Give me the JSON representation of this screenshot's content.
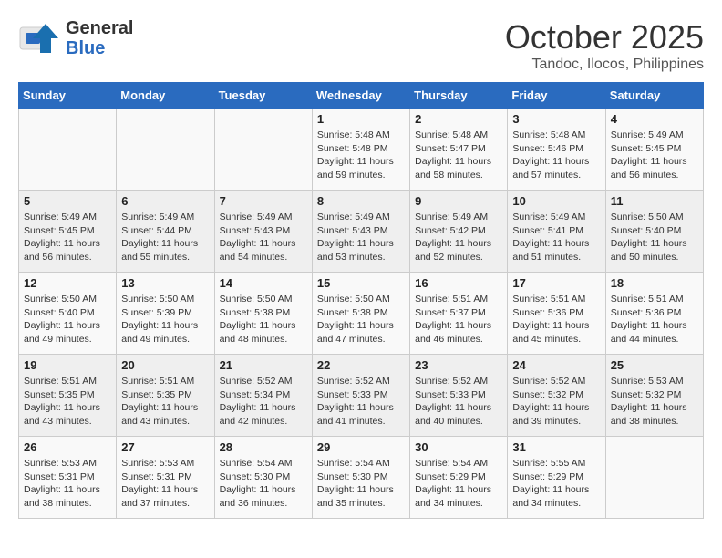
{
  "header": {
    "logo_general": "General",
    "logo_blue": "Blue",
    "month": "October 2025",
    "location": "Tandoc, Ilocos, Philippines"
  },
  "weekdays": [
    "Sunday",
    "Monday",
    "Tuesday",
    "Wednesday",
    "Thursday",
    "Friday",
    "Saturday"
  ],
  "weeks": [
    [
      {
        "day": "",
        "info": ""
      },
      {
        "day": "",
        "info": ""
      },
      {
        "day": "",
        "info": ""
      },
      {
        "day": "1",
        "info": "Sunrise: 5:48 AM\nSunset: 5:48 PM\nDaylight: 11 hours\nand 59 minutes."
      },
      {
        "day": "2",
        "info": "Sunrise: 5:48 AM\nSunset: 5:47 PM\nDaylight: 11 hours\nand 58 minutes."
      },
      {
        "day": "3",
        "info": "Sunrise: 5:48 AM\nSunset: 5:46 PM\nDaylight: 11 hours\nand 57 minutes."
      },
      {
        "day": "4",
        "info": "Sunrise: 5:49 AM\nSunset: 5:45 PM\nDaylight: 11 hours\nand 56 minutes."
      }
    ],
    [
      {
        "day": "5",
        "info": "Sunrise: 5:49 AM\nSunset: 5:45 PM\nDaylight: 11 hours\nand 56 minutes."
      },
      {
        "day": "6",
        "info": "Sunrise: 5:49 AM\nSunset: 5:44 PM\nDaylight: 11 hours\nand 55 minutes."
      },
      {
        "day": "7",
        "info": "Sunrise: 5:49 AM\nSunset: 5:43 PM\nDaylight: 11 hours\nand 54 minutes."
      },
      {
        "day": "8",
        "info": "Sunrise: 5:49 AM\nSunset: 5:43 PM\nDaylight: 11 hours\nand 53 minutes."
      },
      {
        "day": "9",
        "info": "Sunrise: 5:49 AM\nSunset: 5:42 PM\nDaylight: 11 hours\nand 52 minutes."
      },
      {
        "day": "10",
        "info": "Sunrise: 5:49 AM\nSunset: 5:41 PM\nDaylight: 11 hours\nand 51 minutes."
      },
      {
        "day": "11",
        "info": "Sunrise: 5:50 AM\nSunset: 5:40 PM\nDaylight: 11 hours\nand 50 minutes."
      }
    ],
    [
      {
        "day": "12",
        "info": "Sunrise: 5:50 AM\nSunset: 5:40 PM\nDaylight: 11 hours\nand 49 minutes."
      },
      {
        "day": "13",
        "info": "Sunrise: 5:50 AM\nSunset: 5:39 PM\nDaylight: 11 hours\nand 49 minutes."
      },
      {
        "day": "14",
        "info": "Sunrise: 5:50 AM\nSunset: 5:38 PM\nDaylight: 11 hours\nand 48 minutes."
      },
      {
        "day": "15",
        "info": "Sunrise: 5:50 AM\nSunset: 5:38 PM\nDaylight: 11 hours\nand 47 minutes."
      },
      {
        "day": "16",
        "info": "Sunrise: 5:51 AM\nSunset: 5:37 PM\nDaylight: 11 hours\nand 46 minutes."
      },
      {
        "day": "17",
        "info": "Sunrise: 5:51 AM\nSunset: 5:36 PM\nDaylight: 11 hours\nand 45 minutes."
      },
      {
        "day": "18",
        "info": "Sunrise: 5:51 AM\nSunset: 5:36 PM\nDaylight: 11 hours\nand 44 minutes."
      }
    ],
    [
      {
        "day": "19",
        "info": "Sunrise: 5:51 AM\nSunset: 5:35 PM\nDaylight: 11 hours\nand 43 minutes."
      },
      {
        "day": "20",
        "info": "Sunrise: 5:51 AM\nSunset: 5:35 PM\nDaylight: 11 hours\nand 43 minutes."
      },
      {
        "day": "21",
        "info": "Sunrise: 5:52 AM\nSunset: 5:34 PM\nDaylight: 11 hours\nand 42 minutes."
      },
      {
        "day": "22",
        "info": "Sunrise: 5:52 AM\nSunset: 5:33 PM\nDaylight: 11 hours\nand 41 minutes."
      },
      {
        "day": "23",
        "info": "Sunrise: 5:52 AM\nSunset: 5:33 PM\nDaylight: 11 hours\nand 40 minutes."
      },
      {
        "day": "24",
        "info": "Sunrise: 5:52 AM\nSunset: 5:32 PM\nDaylight: 11 hours\nand 39 minutes."
      },
      {
        "day": "25",
        "info": "Sunrise: 5:53 AM\nSunset: 5:32 PM\nDaylight: 11 hours\nand 38 minutes."
      }
    ],
    [
      {
        "day": "26",
        "info": "Sunrise: 5:53 AM\nSunset: 5:31 PM\nDaylight: 11 hours\nand 38 minutes."
      },
      {
        "day": "27",
        "info": "Sunrise: 5:53 AM\nSunset: 5:31 PM\nDaylight: 11 hours\nand 37 minutes."
      },
      {
        "day": "28",
        "info": "Sunrise: 5:54 AM\nSunset: 5:30 PM\nDaylight: 11 hours\nand 36 minutes."
      },
      {
        "day": "29",
        "info": "Sunrise: 5:54 AM\nSunset: 5:30 PM\nDaylight: 11 hours\nand 35 minutes."
      },
      {
        "day": "30",
        "info": "Sunrise: 5:54 AM\nSunset: 5:29 PM\nDaylight: 11 hours\nand 34 minutes."
      },
      {
        "day": "31",
        "info": "Sunrise: 5:55 AM\nSunset: 5:29 PM\nDaylight: 11 hours\nand 34 minutes."
      },
      {
        "day": "",
        "info": ""
      }
    ]
  ]
}
